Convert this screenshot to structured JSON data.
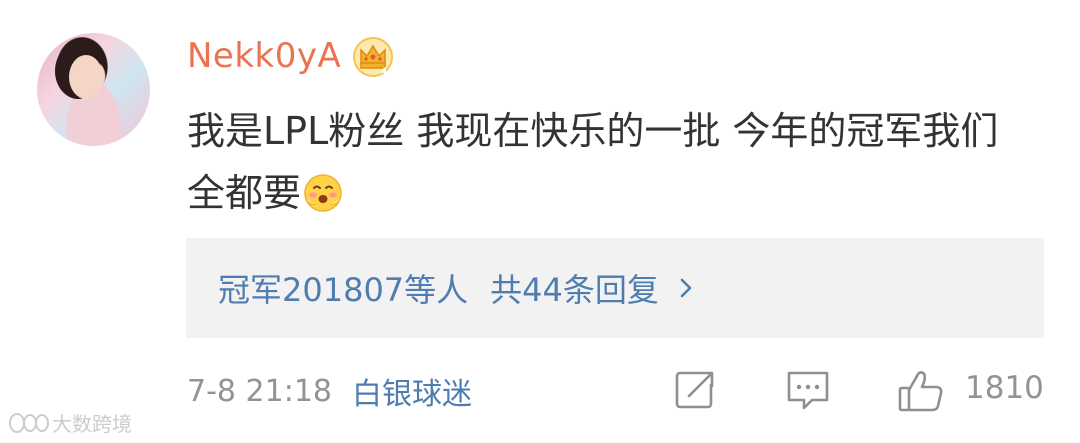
{
  "comment": {
    "username": "Nekk0yA",
    "text": "我是LPL粉丝 我现在快乐的一批 今年的冠军我们全都要",
    "timestamp": "7-8 21:18",
    "source": "白银球迷"
  },
  "replies": {
    "who": "冠军201807等人",
    "count_text": "共44条回复"
  },
  "actions": {
    "like_count": "1810"
  },
  "watermark": {
    "text": "大数跨境"
  },
  "icons": {
    "badge": "crown-badge-icon",
    "emoji": "smiling-blush-emoji-icon",
    "forward": "forward-icon",
    "comment": "comment-icon",
    "like": "thumbs-up-icon",
    "chevron": "chevron-right-icon"
  },
  "colors": {
    "username": "#eb7350",
    "link": "#507daf",
    "meta": "#939393",
    "reply_bg": "#f2f2f2"
  }
}
